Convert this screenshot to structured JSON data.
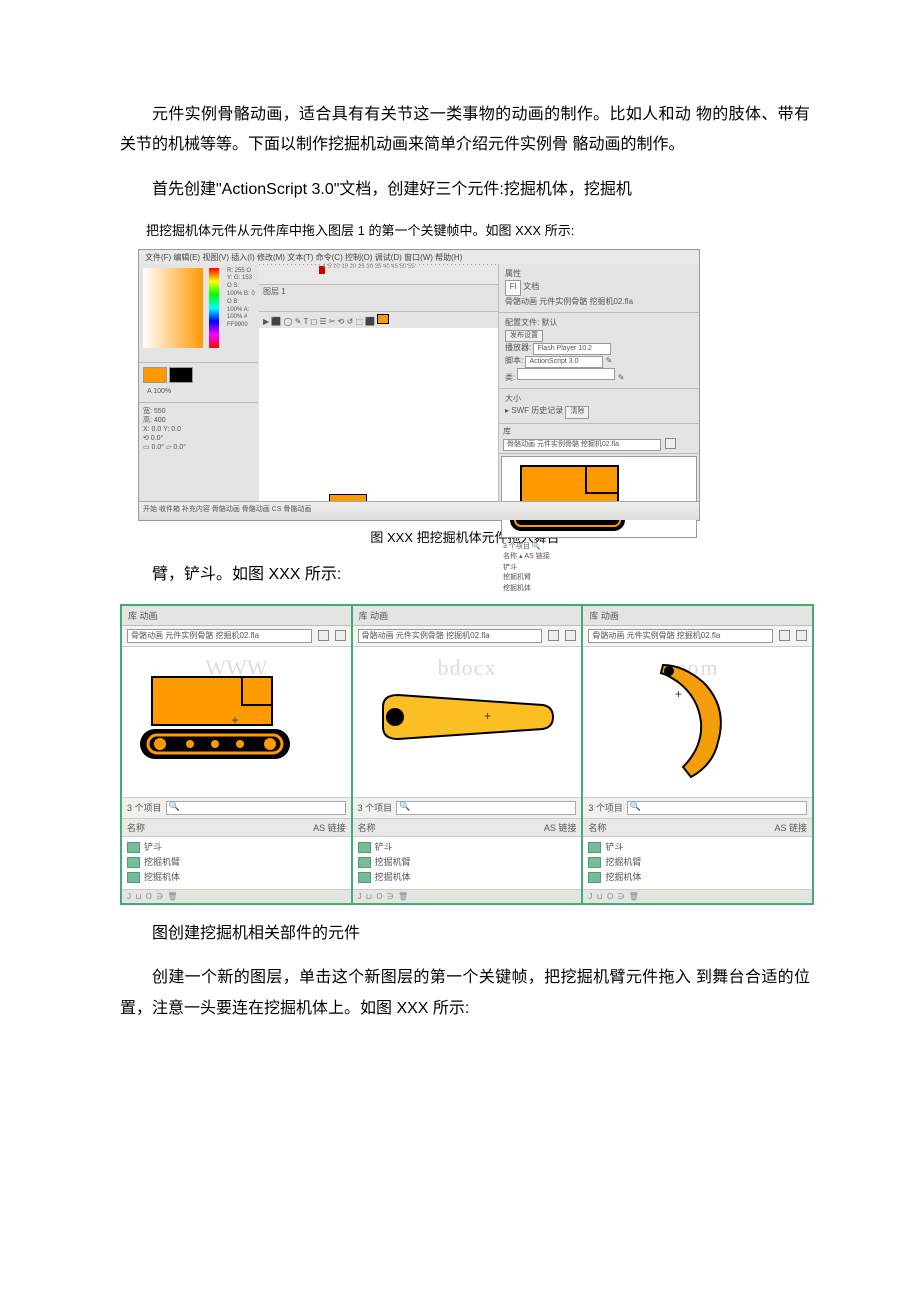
{
  "paragraphs": {
    "p1": "元件实例骨骼动画，适合具有有关节这一类事物的动画的制作。比如人和动 物的肢体、带有关节的机械等等。下面以制作挖掘机动画来简单介绍元件实例骨 骼动画的制作。",
    "p2": "首先创建\"ActionScript 3.0\"文档，创建好三个元件:挖掘机体，挖掘机",
    "p3": "把挖掘机体元件从元件库中拖入图层 1 的第一个关键帧中。如图 XXX 所示:",
    "p4": "臂，铲斗。如图 XXX 所示:",
    "p5": "图创建挖掘机相关部件的元件",
    "p6": "创建一个新的图层，单击这个新图层的第一个关键帧，把挖掘机臂元件拖入 到舞台合适的位置，注意一头要连在挖掘机体上。如图 XXX 所示:"
  },
  "caption1": "图 XXX 把挖掘机体元件拖入舞台",
  "flash": {
    "menubar": "文件(F)  编辑(E)  视图(V)  插入(I)  修改(M)  文本(T)  命令(C)  控制(O)  调试(D)  窗口(W)  帮助(H)",
    "doc_title": "骨骼动画 元件实例骨骼 挖掘机02.fla",
    "color_readout": "R: 255  O Y:  G: 153  O S: 100%  B: 0    O B: 100%  A: 100%  # FF9900",
    "alpha_label": "A 100%",
    "props": {
      "fps_label": "配置文件: 默认",
      "publish_label": "发布设置",
      "player_label": "播放器:",
      "player_val": "Flash Player 10.2",
      "script_label": "脚本:",
      "script_val": "ActionScript 3.0",
      "class_label": "类:",
      "size_label": "大小",
      "history_label": "SWF 历史记录",
      "clear_btn": "清除"
    },
    "taskbar": "开始    收件箱    补充内容    骨骼动画    骨骼动画    CS    骨骼动画",
    "lib_items": [
      "铲斗",
      "挖掘机臂",
      "挖掘机体"
    ],
    "lib_linkage": "AS 链接"
  },
  "library": {
    "tab": "库  动画",
    "dropdown": "骨骼动画 元件实例骨骼 挖掘机02.fla",
    "count": "3 个项目",
    "col_name": "名称",
    "col_linkage": "AS 链接",
    "items": [
      "铲斗",
      "挖掘机臂",
      "挖掘机体"
    ],
    "footer": "J ⊔ O ∋ 🗑",
    "watermarks": [
      "WWW",
      "bdocx",
      "com"
    ]
  }
}
